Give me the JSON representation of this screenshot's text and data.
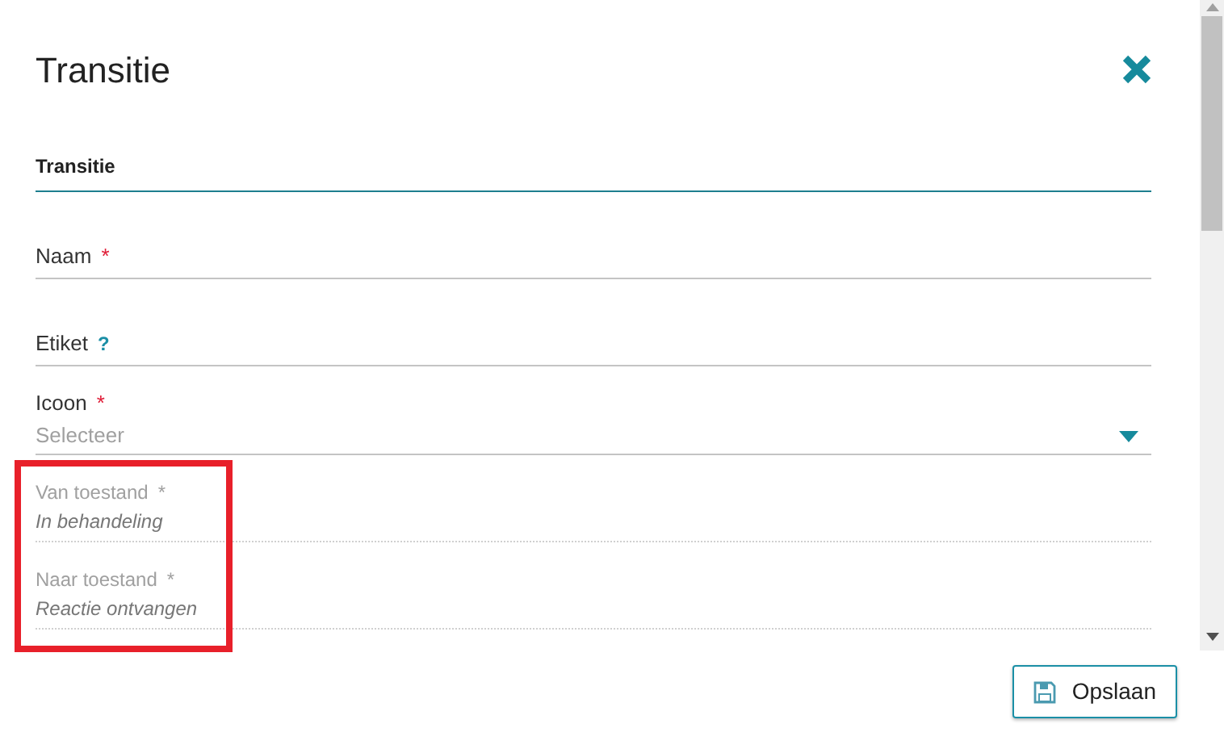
{
  "dialog": {
    "title": "Transitie"
  },
  "section": {
    "title": "Transitie"
  },
  "fields": [
    {
      "kind": "input",
      "label": "Naam",
      "required": "*"
    },
    {
      "kind": "input",
      "label": "Etiket",
      "help": "?"
    },
    {
      "kind": "select",
      "label": "Icoon",
      "required": "*",
      "placeholder": "Selecteer"
    }
  ],
  "readonly_group": {
    "highlighted": true,
    "fields": [
      {
        "label": "Van toestand",
        "required": "*",
        "value": "In behandeling"
      },
      {
        "label": "Naar toestand",
        "required": "*",
        "value": "Reactie ontvangen"
      }
    ]
  },
  "save_button": {
    "label": "Opslaan"
  }
}
